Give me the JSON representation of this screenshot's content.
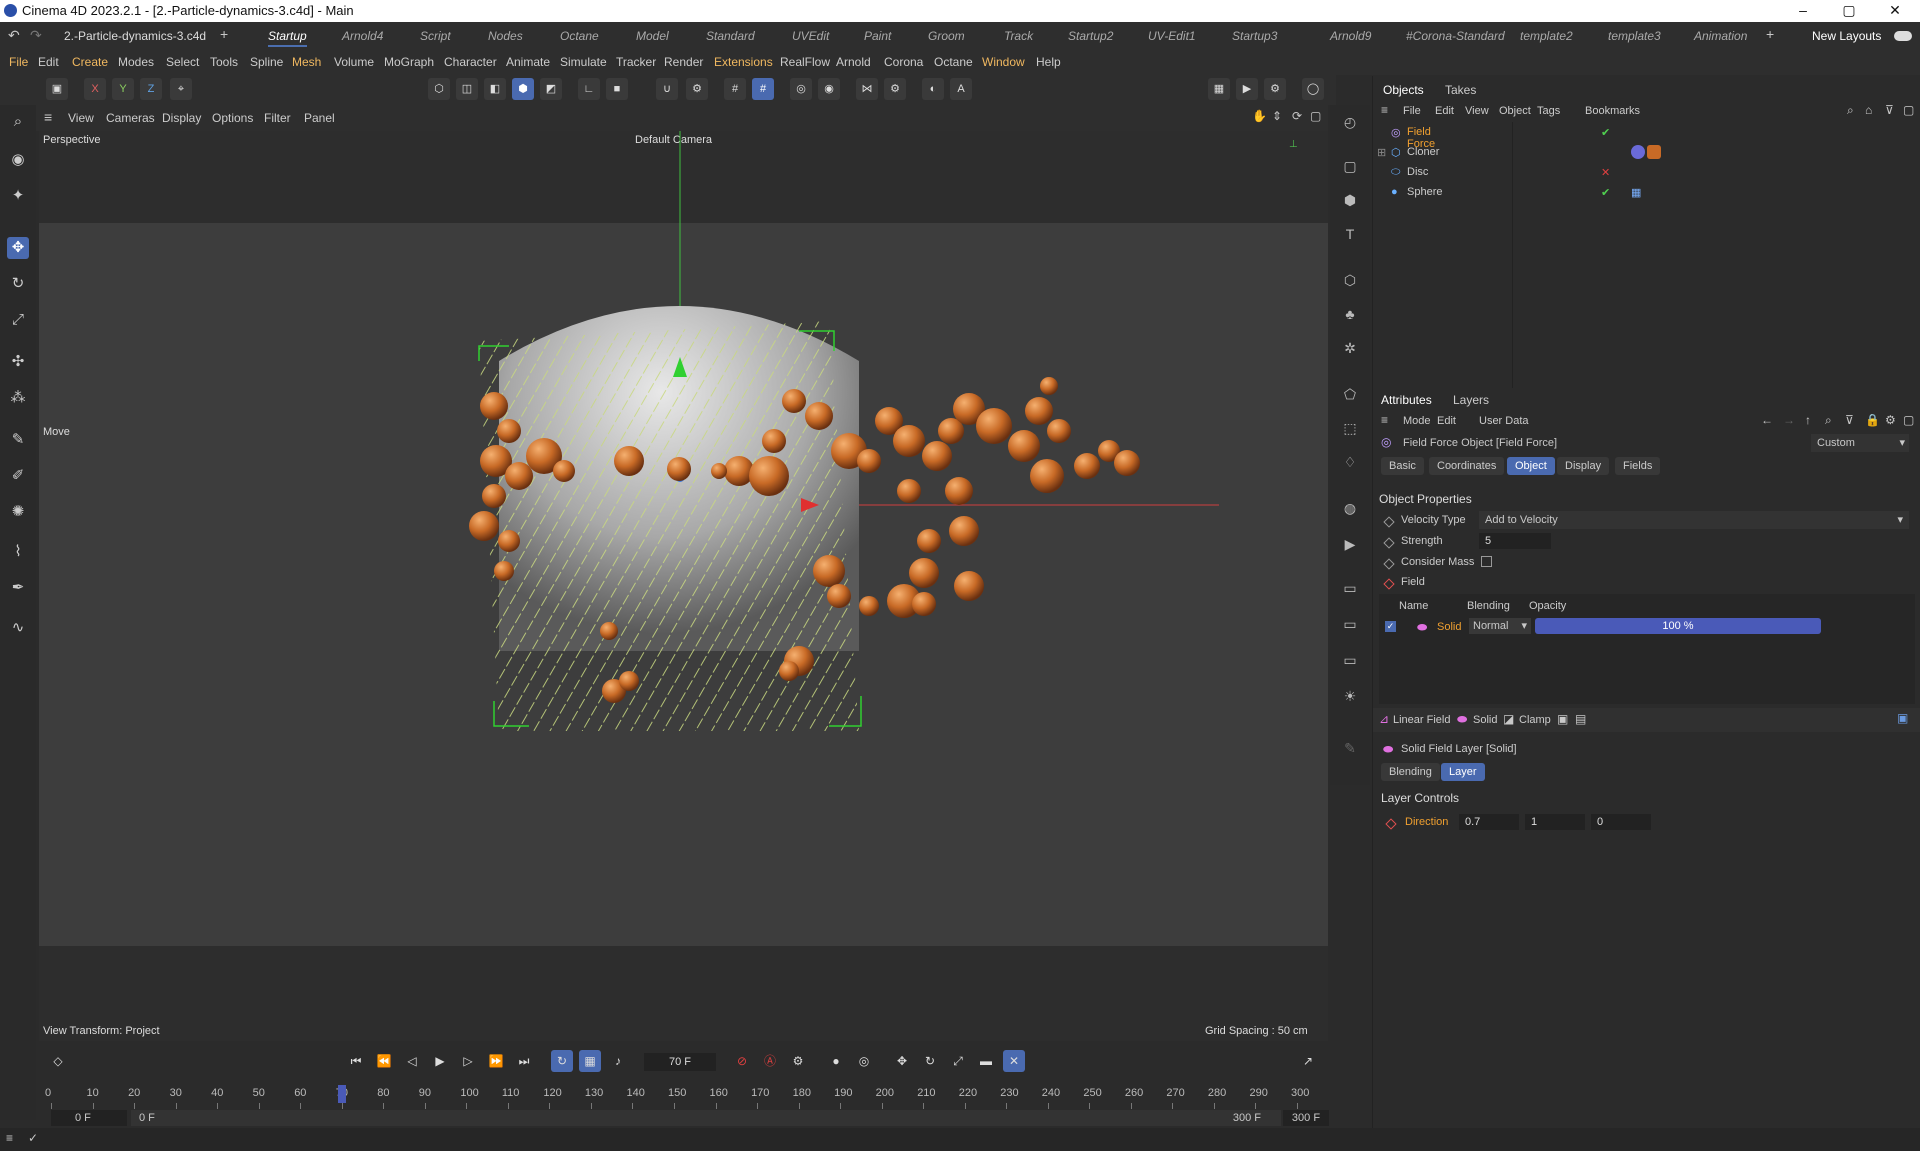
{
  "window": {
    "title": "Cinema 4D 2023.2.1 - [2.-Particle-dynamics-3.c4d] - Main",
    "minimize": "–",
    "maximize": "▢",
    "close": "✕"
  },
  "layouts": {
    "doc_tab": "2.-Particle-dynamics-3.c4d",
    "add": "+",
    "tabs": [
      "Startup",
      "Arnold4",
      "Script",
      "Nodes",
      "Octane",
      "Model",
      "Standard",
      "UVEdit",
      "Paint",
      "Groom",
      "Track",
      "Startup2",
      "UV-Edit1",
      "Startup3",
      "Arnold9",
      "#Corona-Standard",
      "template2",
      "template3",
      "Animation"
    ],
    "new_layouts": "New Layouts"
  },
  "menu": [
    "File",
    "Edit",
    "Create",
    "Modes",
    "Select",
    "Tools",
    "Spline",
    "Mesh",
    "Volume",
    "MoGraph",
    "Character",
    "Animate",
    "Simulate",
    "Tracker",
    "Render",
    "Extensions",
    "RealFlow",
    "Arnold",
    "Corona",
    "Octane",
    "Window",
    "Help"
  ],
  "axis_buttons": [
    "X",
    "Y",
    "Z"
  ],
  "viewport": {
    "menu": [
      "View",
      "Cameras",
      "Display",
      "Options",
      "Filter",
      "Panel"
    ],
    "label": "Perspective",
    "camera": "Default Camera",
    "move_label": "Move",
    "view_transform": "View Transform: Project",
    "grid_spacing": "Grid Spacing : 50 cm"
  },
  "objects_panel": {
    "tabs": [
      "Objects",
      "Takes"
    ],
    "menu": [
      "File",
      "Edit",
      "View",
      "Object",
      "Tags",
      "Bookmarks"
    ],
    "items": [
      {
        "name": "Field Force",
        "color": "#f0a030"
      },
      {
        "name": "Cloner",
        "color": "#cccccc"
      },
      {
        "name": "Disc",
        "color": "#cccccc"
      },
      {
        "name": "Sphere",
        "color": "#cccccc"
      }
    ]
  },
  "attributes": {
    "tabs": [
      "Attributes",
      "Layers"
    ],
    "menu": [
      "Mode",
      "Edit",
      "User Data"
    ],
    "object_title": "Field Force Object [Field Force]",
    "preset": "Custom",
    "subtabs": [
      "Basic",
      "Coordinates",
      "Object",
      "Display",
      "Fields"
    ],
    "section": "Object Properties",
    "velocity_type_label": "Velocity Type",
    "velocity_type_value": "Add to Velocity",
    "strength_label": "Strength",
    "strength_value": "5",
    "consider_mass_label": "Consider Mass",
    "field_label": "Field",
    "field_headers": [
      "Name",
      "Blending",
      "Opacity"
    ],
    "field_row": {
      "name": "Solid",
      "blending": "Normal",
      "opacity": "100 %",
      "opacity_fraction": 1.0
    },
    "layer_tools": [
      "Linear Field",
      "Solid",
      "Clamp"
    ],
    "layer_title": "Solid Field Layer [Solid]",
    "layer_tabs": [
      "Blending",
      "Layer"
    ],
    "layer_controls": "Layer Controls",
    "direction_label": "Direction",
    "direction": [
      "0.7",
      "1",
      "0"
    ]
  },
  "timeline": {
    "current_frame": "70 F",
    "ticks": [
      "0",
      "10",
      "20",
      "30",
      "40",
      "50",
      "60",
      "70",
      "80",
      "90",
      "100",
      "110",
      "120",
      "130",
      "140",
      "150",
      "160",
      "170",
      "180",
      "190",
      "200",
      "210",
      "220",
      "230",
      "240",
      "250",
      "260",
      "270",
      "280",
      "290",
      "300"
    ],
    "start_a": "0 F",
    "start_b": "0 F",
    "end_a": "300 F",
    "end_b": "300 F",
    "playhead_frame": 70,
    "max_frame": 300
  }
}
